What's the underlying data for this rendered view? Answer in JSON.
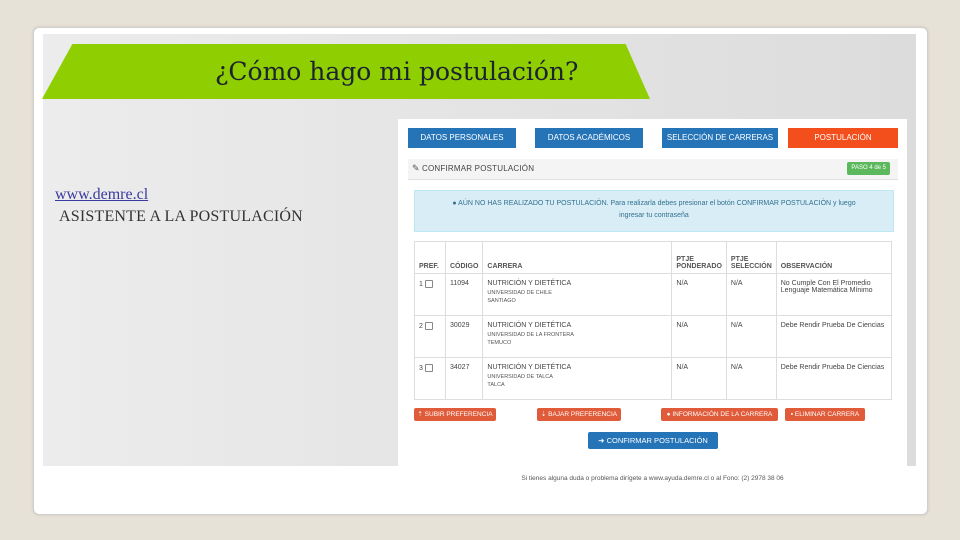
{
  "slide": {
    "title": "¿Cómo hago mi postulación?",
    "link_text": "www.demre.cl",
    "subtitle": "ASISTENTE A LA POSTULACIÓN",
    "accent_color": "#8fce00"
  },
  "screenshot": {
    "steps": [
      "DATOS PERSONALES",
      "DATOS ACADÉMICOS",
      "SELECCIÓN DE CARRERAS",
      "POSTULACIÓN"
    ],
    "panel_title": "CONFIRMAR POSTULACIÓN",
    "paso_badge": "PASO 4 de 5",
    "alert_line1": "AÚN NO HAS REALIZADO TU POSTULACIÓN. Para realizarla debes presionar el botón CONFIRMAR POSTULACIÓN y luego",
    "alert_line2": "ingresar tu contraseña",
    "table": {
      "headers": [
        "PREF.",
        "CÓDIGO",
        "CARRERA",
        "PTJE PONDERADO",
        "PTJE SELECCIÓN",
        "OBSERVACIÓN"
      ],
      "rows": [
        {
          "pref": "1",
          "codigo": "11094",
          "carrera": "NUTRICIÓN Y DIETÉTICA",
          "universidad": "UNIVERSIDAD DE CHILE",
          "ciudad": "SANTIAGO",
          "ponderado": "N/A",
          "seleccion": "N/A",
          "observacion": "No Cumple Con El Promedio Lenguaje Matemática Mínimo"
        },
        {
          "pref": "2",
          "codigo": "30029",
          "carrera": "NUTRICIÓN Y DIETÉTICA",
          "universidad": "UNIVERSIDAD DE LA FRONTERA",
          "ciudad": "TEMUCO",
          "ponderado": "N/A",
          "seleccion": "N/A",
          "observacion": "Debe Rendir Prueba De Ciencias"
        },
        {
          "pref": "3",
          "codigo": "34027",
          "carrera": "NUTRICIÓN Y DIETÉTICA",
          "universidad": "UNIVERSIDAD DE TALCA",
          "ciudad": "TALCA",
          "ponderado": "N/A",
          "seleccion": "N/A",
          "observacion": "Debe Rendir Prueba De Ciencias"
        }
      ]
    },
    "buttons": {
      "subir": "SUBIR PREFERENCIA",
      "bajar": "BAJAR PREFERENCIA",
      "info": "INFORMACIÓN DE LA CARRERA",
      "eliminar": "ELIMINAR CARRERA",
      "confirmar": "CONFIRMAR POSTULACIÓN"
    },
    "footer": "Si tienes alguna duda o problema dirígete a www.ayuda.demre.cl o al Fono: (2) 2978 38 06"
  }
}
